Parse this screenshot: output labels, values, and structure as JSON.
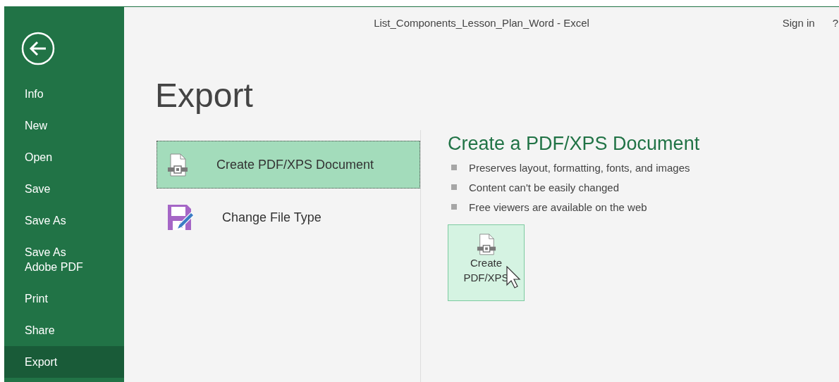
{
  "window": {
    "title": "List_Components_Lesson_Plan_Word  -  Excel",
    "sign_in": "Sign in",
    "help": "?"
  },
  "sidebar": {
    "items": [
      {
        "label": "Info",
        "selected": false
      },
      {
        "label": "New",
        "selected": false
      },
      {
        "label": "Open",
        "selected": false
      },
      {
        "label": "Save",
        "selected": false
      },
      {
        "label": "Save As",
        "selected": false
      },
      {
        "label": "Save As\nAdobe PDF",
        "selected": false
      },
      {
        "label": "Print",
        "selected": false
      },
      {
        "label": "Share",
        "selected": false
      },
      {
        "label": "Export",
        "selected": true
      }
    ]
  },
  "page_title": "Export",
  "options": [
    {
      "label": "Create PDF/XPS Document",
      "kind": "pdf",
      "selected": true
    },
    {
      "label": "Change File Type",
      "kind": "filetype",
      "selected": false
    }
  ],
  "detail": {
    "heading": "Create a PDF/XPS Document",
    "bullets": [
      "Preserves layout, formatting, fonts, and images",
      "Content can't be easily changed",
      "Free viewers are available on the web"
    ],
    "button": {
      "label": "Create\nPDF/XPS"
    }
  }
}
